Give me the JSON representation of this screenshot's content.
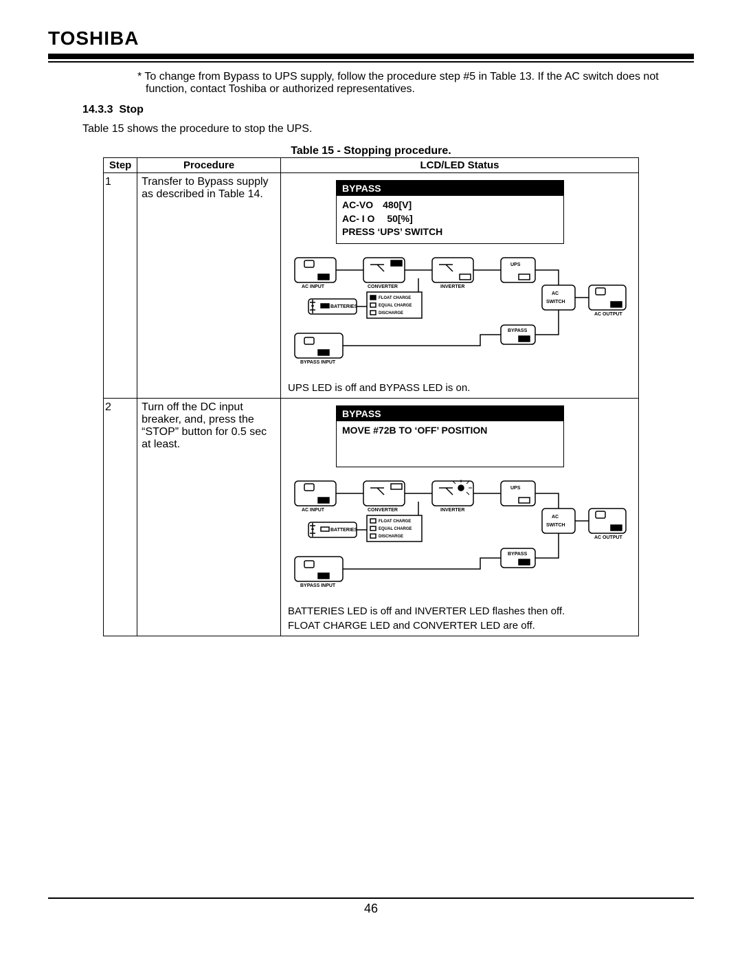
{
  "brand": "TOSHIBA",
  "note": "* To change from Bypass to UPS supply, follow the procedure step #5 in Table 13. If the AC switch does not function, contact Toshiba or authorized representatives.",
  "section_number": "14.3.3",
  "section_title": "Stop",
  "intro": "Table 15 shows the procedure to stop the UPS.",
  "table_caption": "Table 15 - Stopping procedure.",
  "headers": {
    "step": "Step",
    "procedure": "Procedure",
    "status": "LCD/LED Status"
  },
  "rows": [
    {
      "step": "1",
      "procedure": "Transfer to Bypass supply as described in Table 14.",
      "lcd": {
        "header": "BYPASS",
        "lines": [
          "AC-VO 480[V]",
          "AC- I O  50[%]",
          "PRESS ‘UPS’ SWITCH"
        ]
      },
      "diagram_labels": {
        "ac_input": "AC INPUT",
        "converter": "CONVERTER",
        "inverter": "INVERTER",
        "ups": "UPS",
        "ac_switch1": "AC",
        "ac_switch2": "SWITCH",
        "ac_output": "AC OUTPUT",
        "batteries": "BATTERIES",
        "float_charge": "FLOAT CHARGE",
        "equal_charge": "EQUAL CHARGE",
        "discharge": "DISCHARGE",
        "bypass_input": "BYPASS INPUT",
        "bypass": "BYPASS"
      },
      "status_note": "UPS LED is off and BYPASS LED is on."
    },
    {
      "step": "2",
      "procedure": "Turn off the DC input breaker, and, press the “STOP”  button for 0.5 sec at least.",
      "lcd": {
        "header": "BYPASS",
        "lines": [
          "",
          "MOVE #72B TO ‘OFF’ POSITION",
          ""
        ]
      },
      "diagram_labels": {
        "ac_input": "AC INPUT",
        "converter": "CONVERTER",
        "inverter": "INVERTER",
        "ups": "UPS",
        "ac_switch1": "AC",
        "ac_switch2": "SWITCH",
        "ac_output": "AC OUTPUT",
        "batteries": "BATTERIES",
        "float_charge": "FLOAT CHARGE",
        "equal_charge": "EQUAL CHARGE",
        "discharge": "DISCHARGE",
        "bypass_input": "BYPASS INPUT",
        "bypass": "BYPASS"
      },
      "status_notes": [
        "BATTERIES LED is off and INVERTER LED flashes then off.",
        "FLOAT CHARGE LED and CONVERTER LED are off."
      ]
    }
  ],
  "page_number": "46"
}
